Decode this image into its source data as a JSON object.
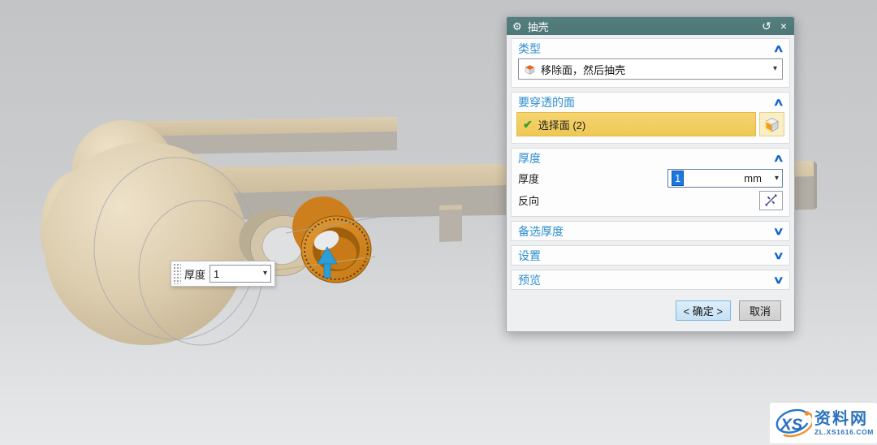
{
  "dialog": {
    "title": "抽壳",
    "type": {
      "label": "类型",
      "dropdown_value": "移除面，然后抽壳"
    },
    "faces": {
      "label": "要穿透的面",
      "select_label": "选择面 (2)"
    },
    "thickness": {
      "label": "厚度",
      "field_label": "厚度",
      "value": "1",
      "unit": "mm",
      "reverse_label": "反向"
    },
    "alt_thickness": {
      "label": "备选厚度"
    },
    "settings": {
      "label": "设置"
    },
    "preview": {
      "label": "预览"
    },
    "footer": {
      "ok": "< 确定 >",
      "cancel": "取消"
    }
  },
  "floating_input": {
    "label": "厚度",
    "value": "1"
  },
  "watermark": {
    "monogram": "XS",
    "site_name": "资料网",
    "site_url": "ZL.XS1616.COM"
  },
  "icons": {
    "gear": "⚙",
    "reset": "↺",
    "close": "×",
    "collapse": "∧",
    "expand": "∨",
    "check": "✔",
    "caret_down": "▾"
  },
  "colors": {
    "titlebar": "#4e7a7a",
    "section_header": "#2e8fd0",
    "chevron": "#1565c8",
    "selection_highlight": "#f3cc63",
    "value_selection": "#1c76e0",
    "selected_face_orange": "#d98c26",
    "model_tan": "#d6c8aa",
    "arrow_blue": "#2d9fd8"
  }
}
